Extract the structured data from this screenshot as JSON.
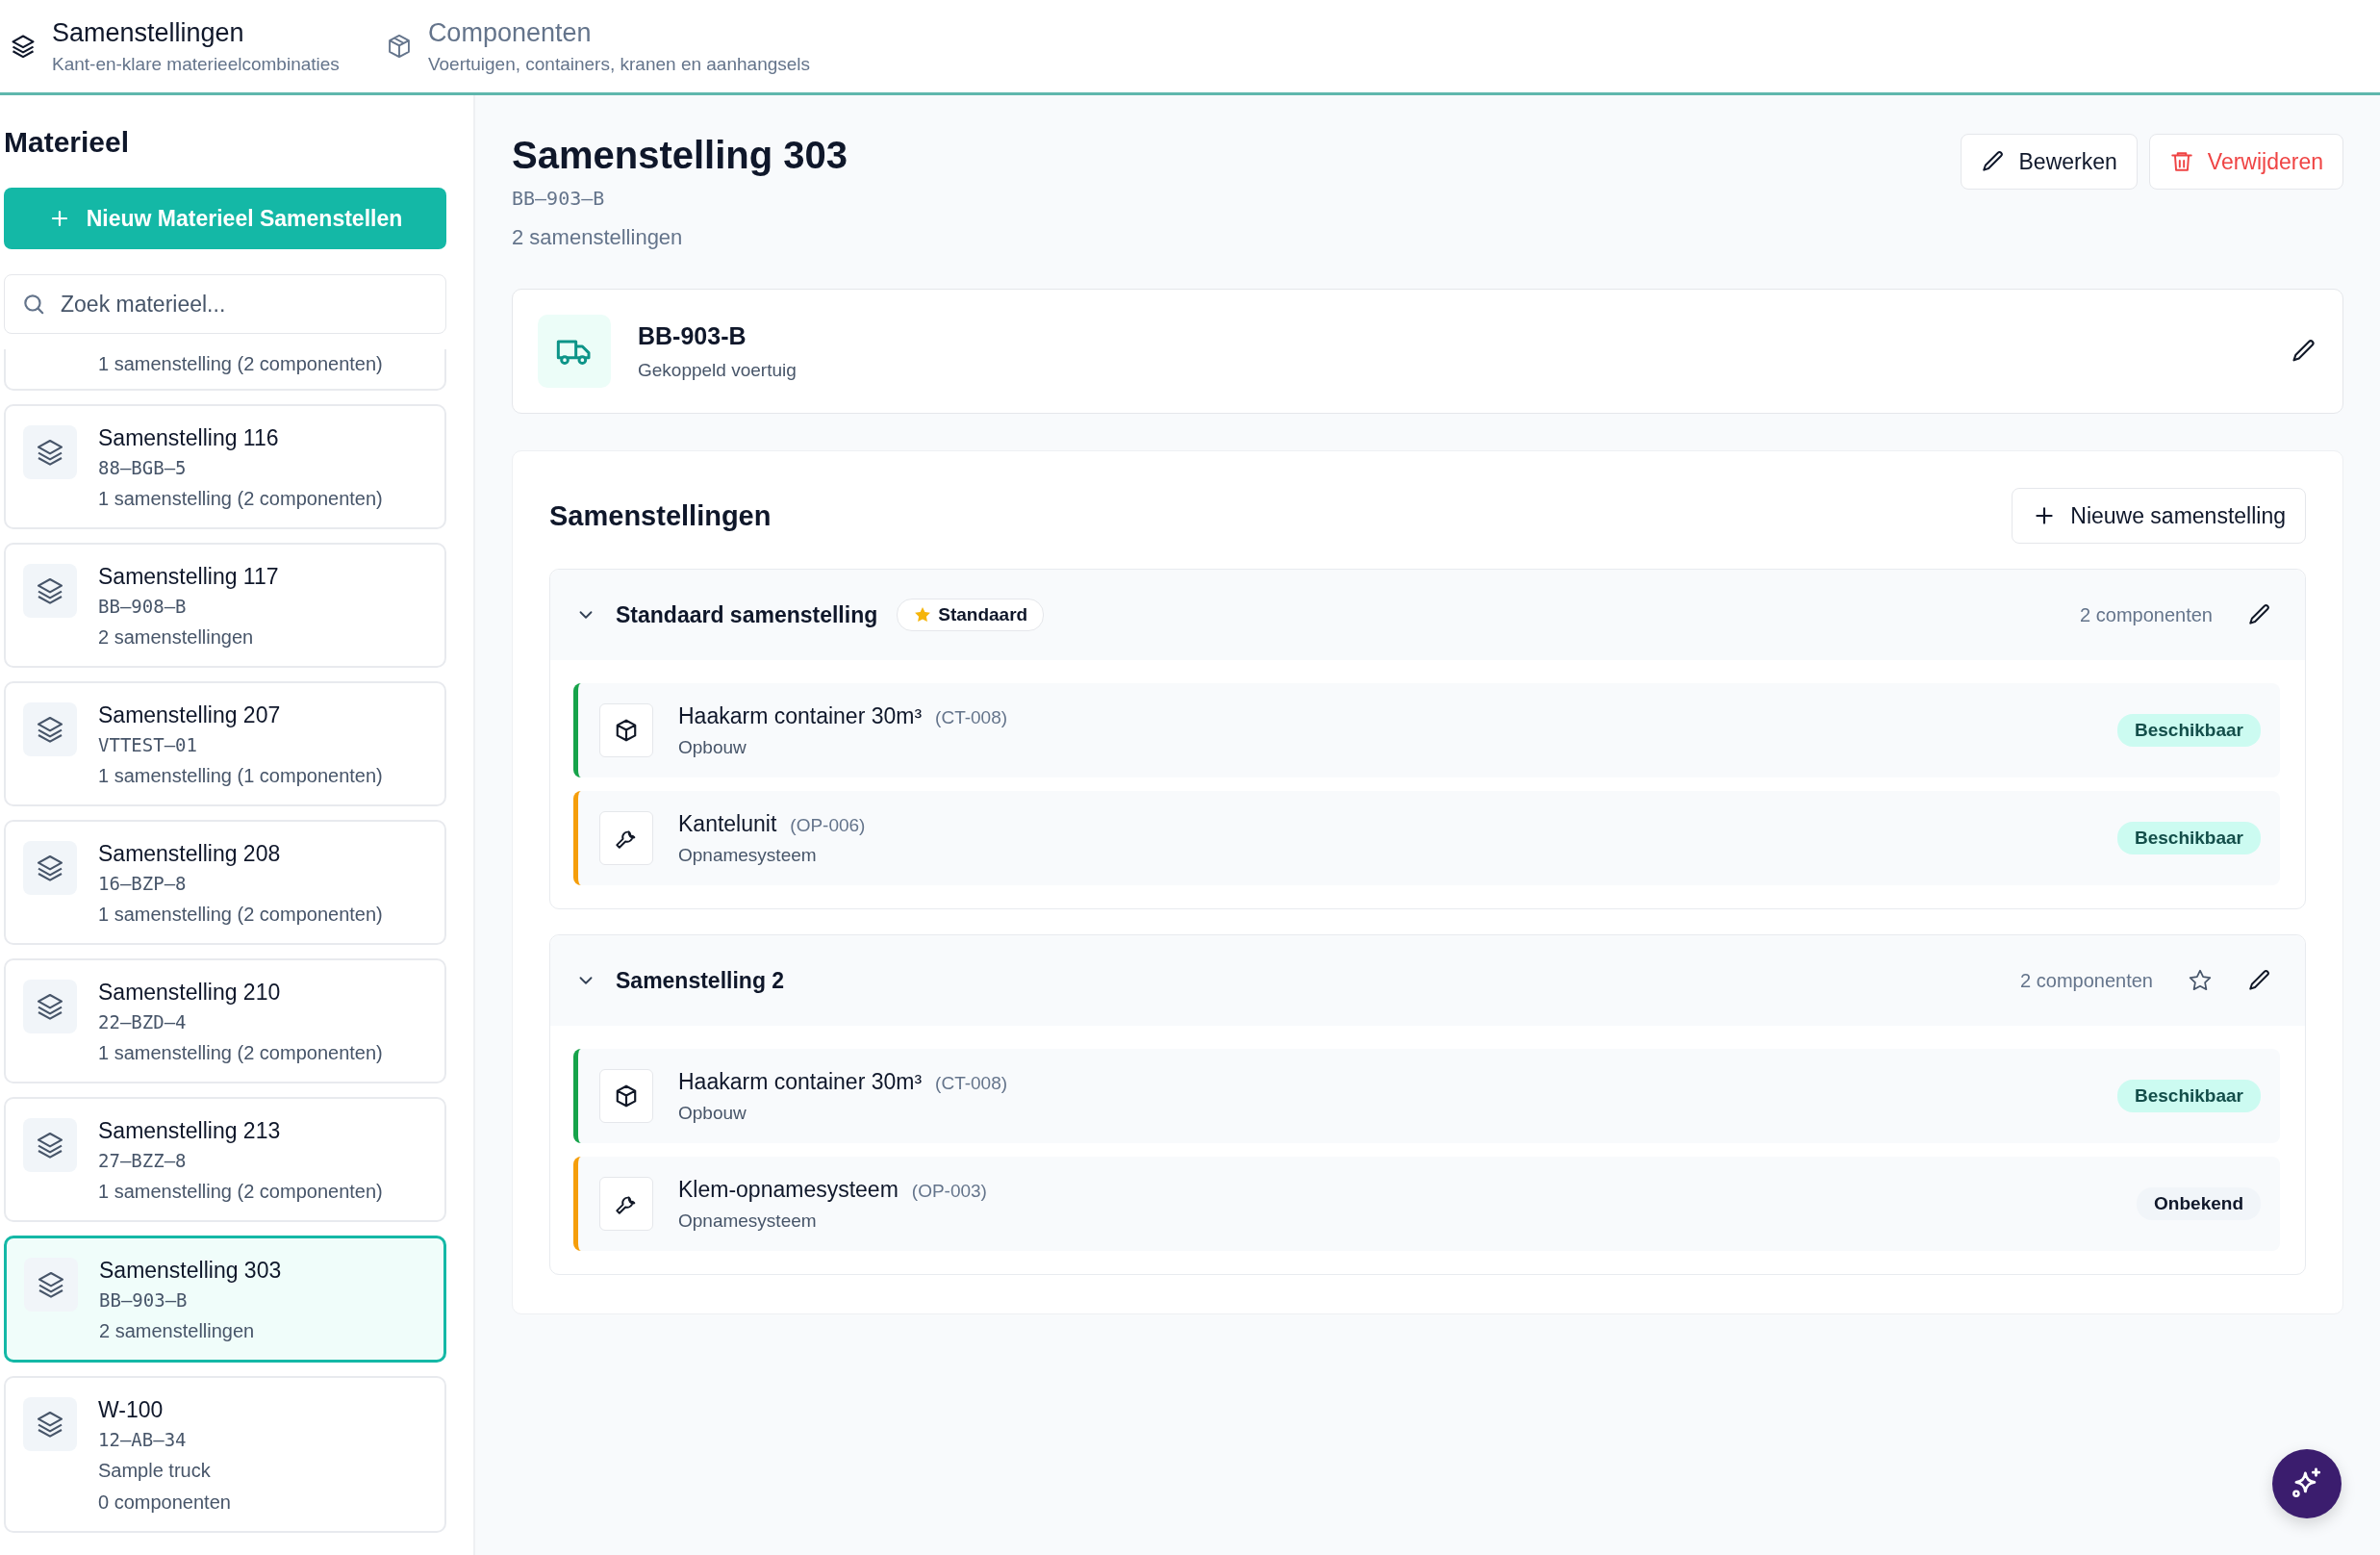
{
  "tabs": [
    {
      "label": "Samenstellingen",
      "subtitle": "Kant-en-klare materieelcombinaties",
      "kind": "layers",
      "selected": true
    },
    {
      "label": "Componenten",
      "subtitle": "Voertuigen, containers, kranen en aanhangsels",
      "kind": "box",
      "selected": false
    }
  ],
  "sidebar": {
    "title": "Materieel",
    "new_button": "Nieuw Materieel Samenstellen",
    "search": {
      "placeholder": "Zoek materieel..."
    },
    "items": [
      {
        "lines": [
          "1 samenstelling (2 componenten)"
        ],
        "selected": false
      },
      {
        "name": "Samenstelling 116",
        "plate": "88–BGB–5",
        "lines": [
          "1 samenstelling (2 componenten)"
        ],
        "selected": false
      },
      {
        "name": "Samenstelling 117",
        "plate": "BB–908–B",
        "lines": [
          "2 samenstellingen"
        ],
        "selected": false
      },
      {
        "name": "Samenstelling 207",
        "plate": "VTTEST–01",
        "lines": [
          "1 samenstelling (1 componenten)"
        ],
        "selected": false
      },
      {
        "name": "Samenstelling 208",
        "plate": "16–BZP–8",
        "lines": [
          "1 samenstelling (2 componenten)"
        ],
        "selected": false
      },
      {
        "name": "Samenstelling 210",
        "plate": "22–BZD–4",
        "lines": [
          "1 samenstelling (2 componenten)"
        ],
        "selected": false
      },
      {
        "name": "Samenstelling 213",
        "plate": "27–BZZ–8",
        "lines": [
          "1 samenstelling (2 componenten)"
        ],
        "selected": false
      },
      {
        "name": "Samenstelling 303",
        "plate": "BB–903–B",
        "lines": [
          "2 samenstellingen"
        ],
        "selected": true
      },
      {
        "name": "W-100",
        "plate": "12–AB–34",
        "lines": [
          "Sample truck",
          "0 componenten"
        ],
        "selected": false
      }
    ]
  },
  "detail": {
    "title": "Samenstelling 303",
    "plate": "BB–903–B",
    "summary": "2 samenstellingen",
    "edit_button": "Bewerken",
    "delete_button": "Verwijderen",
    "vehicle": {
      "plate": "BB-903-B",
      "label": "Gekoppeld voertuig"
    },
    "section_title": "Samenstellingen",
    "new_button": "Nieuwe samenstelling",
    "groups": [
      {
        "name": "Standaard samenstelling",
        "is_default": true,
        "badge": "Standaard",
        "expanded": true,
        "count": "2 componenten",
        "components": [
          {
            "name": "Haakarm container 30m³",
            "code": "(CT-008)",
            "type": "Opbouw",
            "kind": "box",
            "color": "#16a34a",
            "status": {
              "label": "Beschikbaar",
              "kind": "available"
            }
          },
          {
            "name": "Kantelunit",
            "code": "(OP-006)",
            "type": "Opnamesysteem",
            "kind": "wrench",
            "color": "#f59e0b",
            "status": {
              "label": "Beschikbaar",
              "kind": "available"
            }
          }
        ]
      },
      {
        "name": "Samenstelling 2",
        "is_default": false,
        "expanded": true,
        "count": "2 componenten",
        "components": [
          {
            "name": "Haakarm container 30m³",
            "code": "(CT-008)",
            "type": "Opbouw",
            "kind": "box",
            "color": "#16a34a",
            "status": {
              "label": "Beschikbaar",
              "kind": "available"
            }
          },
          {
            "name": "Klem-opnamesysteem",
            "code": "(OP-003)",
            "type": "Opnamesysteem",
            "kind": "wrench",
            "color": "#f59e0b",
            "status": {
              "label": "Onbekend",
              "kind": "unknown"
            }
          }
        ]
      }
    ]
  }
}
